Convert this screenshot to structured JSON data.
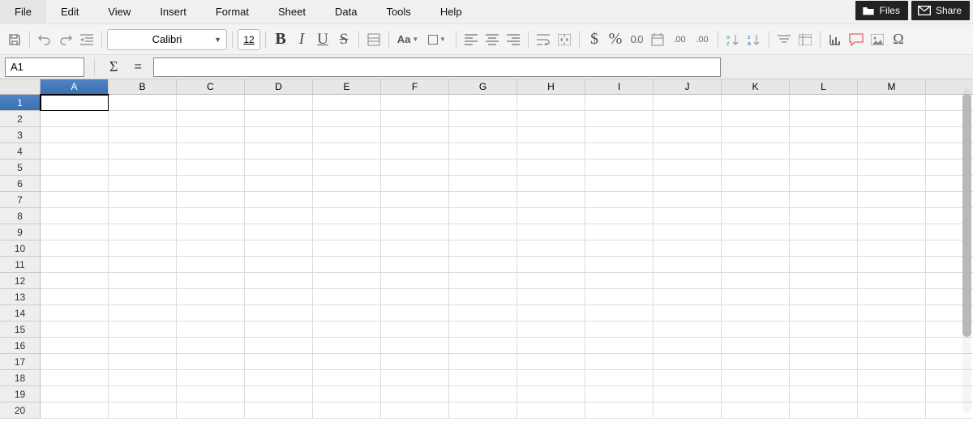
{
  "menu": {
    "items": [
      "File",
      "Edit",
      "View",
      "Insert",
      "Format",
      "Sheet",
      "Data",
      "Tools",
      "Help"
    ]
  },
  "top_actions": {
    "files": "Files",
    "share": "Share"
  },
  "toolbar": {
    "font_name": "Calibri",
    "font_size": "12"
  },
  "formula": {
    "name_box": "A1",
    "input": ""
  },
  "grid": {
    "columns": [
      "A",
      "B",
      "C",
      "D",
      "E",
      "F",
      "G",
      "H",
      "I",
      "J",
      "K",
      "L",
      "M"
    ],
    "rows": [
      "1",
      "2",
      "3",
      "4",
      "5",
      "6",
      "7",
      "8",
      "9",
      "10",
      "11",
      "12",
      "13",
      "14",
      "15",
      "16",
      "17",
      "18",
      "19",
      "20"
    ],
    "selected_cell": "A1"
  }
}
